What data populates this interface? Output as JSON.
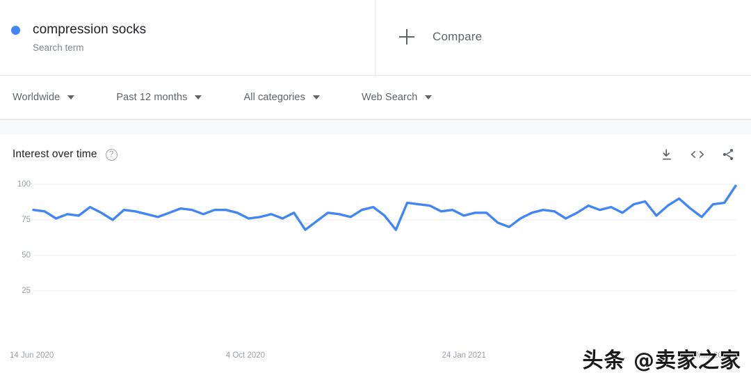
{
  "search_term": {
    "title": "compression socks",
    "subtitle": "Search term",
    "dot_color": "#4285f4"
  },
  "compare": {
    "label": "Compare",
    "icon": "plus-icon"
  },
  "filters": [
    {
      "label": "Worldwide",
      "icon": "chevron-down-icon"
    },
    {
      "label": "Past 12 months",
      "icon": "chevron-down-icon"
    },
    {
      "label": "All categories",
      "icon": "chevron-down-icon"
    },
    {
      "label": "Web Search",
      "icon": "chevron-down-icon"
    }
  ],
  "card": {
    "title": "Interest over time",
    "help_icon": "help-circle-icon",
    "help_glyph": "?",
    "actions": [
      {
        "name": "download-icon",
        "title": "Download"
      },
      {
        "name": "embed-code-icon",
        "title": "Embed"
      },
      {
        "name": "share-icon",
        "title": "Share"
      }
    ]
  },
  "watermark": {
    "text": "头条 @卖家之家"
  },
  "chart_data": {
    "type": "line",
    "title": "Interest over time",
    "xlabel": "",
    "ylabel": "",
    "ylim": [
      0,
      100
    ],
    "yticks": [
      100,
      75,
      50,
      25
    ],
    "grid": true,
    "legend_position": "top-left",
    "line_color": "#4285f4",
    "x_tick_labels": [
      "14 Jun 2020",
      "4 Oct 2020",
      "24 Jan 2021",
      "16 May 2021"
    ],
    "x_tick_positions": [
      0,
      0.3077,
      0.6154,
      0.9615
    ],
    "series": [
      {
        "name": "compression socks",
        "color": "#4285f4",
        "values": [
          82,
          81,
          76,
          79,
          78,
          84,
          80,
          75,
          82,
          81,
          79,
          77,
          80,
          83,
          82,
          79,
          82,
          82,
          80,
          76,
          77,
          79,
          76,
          80,
          68,
          74,
          80,
          79,
          77,
          82,
          84,
          78,
          68,
          87,
          86,
          85,
          81,
          82,
          78,
          80,
          80,
          73,
          70,
          76,
          80,
          82,
          81,
          76,
          80,
          85,
          82,
          84,
          80,
          86,
          88,
          78,
          85,
          90,
          83,
          77,
          86,
          87,
          99
        ]
      }
    ]
  }
}
